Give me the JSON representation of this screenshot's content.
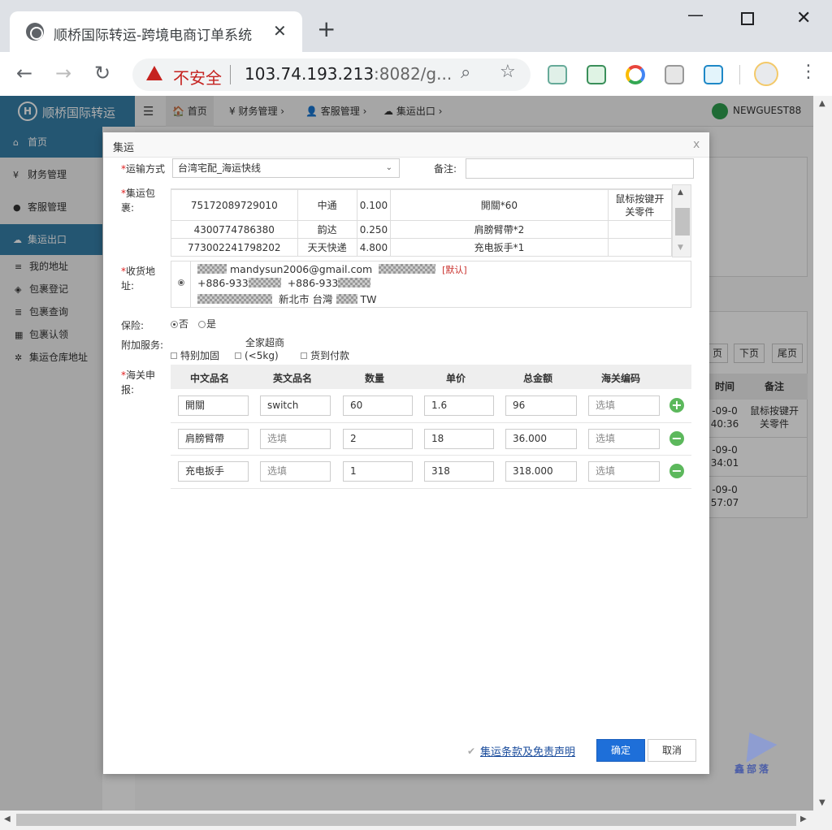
{
  "browser": {
    "tab_title": "顺桥国际转运-跨境电商订单系统",
    "tab_close": "✕",
    "new_tab": "+",
    "security_label": "不安全",
    "url_host": "103.74.193.213",
    "url_rest": ":8082/g...",
    "win_min": "—",
    "win_close": "✕"
  },
  "app": {
    "brand": "顺桥国际转运",
    "menu_toggle": "☰",
    "top_nav": [
      {
        "label": "🏠 首页"
      },
      {
        "label": "¥ 财务管理 ›"
      },
      {
        "label": "👤 客服管理 ›"
      },
      {
        "label": "☁ 集运出口 ›"
      }
    ],
    "user": "NEWGUEST88",
    "sidebar": {
      "home": "首页",
      "finance": "财务管理",
      "service": "客服管理",
      "export": "集运出口",
      "subs": [
        "我的地址",
        "包裹登记",
        "包裹查询",
        "包裹认领",
        "集运仓库地址"
      ]
    },
    "background": {
      "pager": [
        "页",
        "下页",
        "尾页"
      ],
      "headers": [
        "时间",
        "备注"
      ],
      "rows": [
        {
          "time": "-09-0 40:36",
          "remark": "鼠标按键开关零件"
        },
        {
          "time": "-09-0 34:01",
          "remark": ""
        },
        {
          "time": "-09-0 57:07",
          "remark": ""
        }
      ]
    }
  },
  "modal": {
    "title": "集运",
    "close": "x",
    "shipping_label": "运输方式",
    "shipping_value": "台湾宅配_海运快线",
    "remark_label": "备注:",
    "packages_label": "集运包裹:",
    "packages": [
      {
        "tracking": "75172089729010",
        "carrier": "中通",
        "weight": "0.100",
        "contents": "開關*60",
        "note": "鼠标按键开关零件"
      },
      {
        "tracking": "4300774786380",
        "carrier": "韵达",
        "weight": "0.250",
        "contents": "肩膀臂帶*2",
        "note": ""
      },
      {
        "tracking": "773002241798202",
        "carrier": "天天快递",
        "weight": "4.800",
        "contents": "充电扳手*1",
        "note": ""
      }
    ],
    "address_label": "收货地址:",
    "address": {
      "email": "mandysun2006@gmail.com",
      "default_tag": "[默认]",
      "phone1": "+886-933",
      "phone2": "+886-933",
      "city": "新北市",
      "region": "台灣",
      "country": "TW"
    },
    "insurance_label": "保险:",
    "insurance_options": [
      "否",
      "是"
    ],
    "insurance_selected": "否",
    "services_label": "附加服务:",
    "services": [
      "特别加固",
      "全家超商\n(<5kg)",
      "货到付款"
    ],
    "service_top": "全家超商",
    "service_sub": "(<5kg)",
    "customs_label": "海关申报:",
    "customs_headers": [
      "中文品名",
      "英文品名",
      "数量",
      "单价",
      "总金额",
      "海关编码"
    ],
    "customs_rows": [
      {
        "cn": "開關",
        "en": "switch",
        "qty": "60",
        "price": "1.6",
        "total": "96",
        "code": "选填",
        "action": "+"
      },
      {
        "cn": "肩膀臂帶",
        "en": "选填",
        "qty": "2",
        "price": "18",
        "total": "36.000",
        "code": "选填",
        "action": "−"
      },
      {
        "cn": "充电扳手",
        "en": "选填",
        "qty": "1",
        "price": "318",
        "total": "318.000",
        "code": "选填",
        "action": "−"
      }
    ],
    "terms_link": "集运条款及免责声明",
    "ok": "确定",
    "cancel": "取消"
  },
  "watermark": "鑫部落",
  "colors": {
    "brand_blue": "#367fa9",
    "primary_button": "#1e6fd9",
    "add_remove_green": "#5cb85c",
    "insecure_red": "#c5221f"
  }
}
